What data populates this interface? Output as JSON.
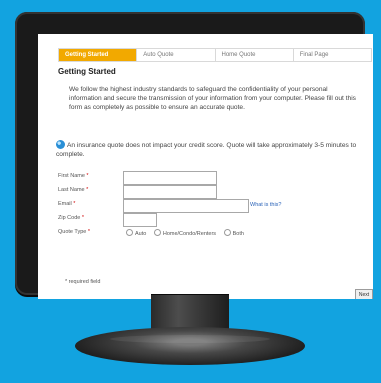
{
  "steps": [
    {
      "label": "Getting Started",
      "active": true
    },
    {
      "label": "Auto Quote",
      "active": false
    },
    {
      "label": "Home Quote",
      "active": false
    },
    {
      "label": "Final Page",
      "active": false
    }
  ],
  "page": {
    "title": "Getting Started",
    "intro": "We follow the highest industry standards to safeguard the confidentiality of your personal information and secure the transmission of your information from your computer. Please fill out this form as completely as possible to ensure an accurate quote.",
    "note": "An insurance quote does not impact your credit score. Quote will take approximately 3-5 minutes to complete."
  },
  "form": {
    "first_name_label": "First Name",
    "last_name_label": "Last Name",
    "email_label": "Email",
    "email_help": "What is this?",
    "zip_label": "Zip Code",
    "quote_type_label": "Quote Type",
    "required_marker": "*",
    "first_name_value": "",
    "last_name_value": "",
    "email_value": "",
    "zip_value": "",
    "quote_types": [
      "Auto",
      "Home/Condo/Renters",
      "Both"
    ],
    "required_note": "* required field"
  },
  "actions": {
    "next_label": "Next"
  }
}
